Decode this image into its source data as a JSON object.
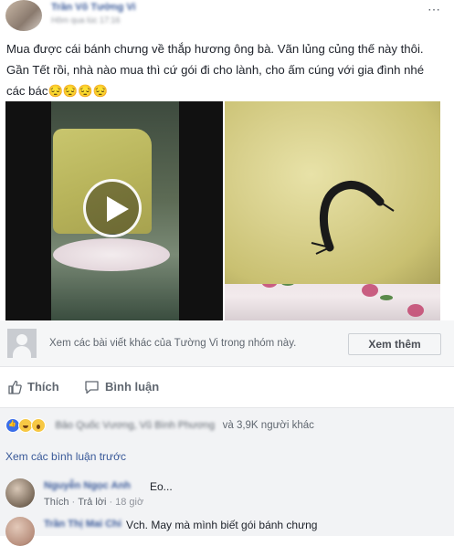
{
  "post": {
    "author": "Trần Võ Tường Vi",
    "meta": "Hôm qua lúc 17:16",
    "more_icon": "⋯",
    "caption": "Mua được cái bánh chưng về thắp hương ông bà. Vãn lủng củng thế này thôi. Gần Tết rồi, nhà nào mua thì cứ gói đi cho lành, cho ấm cúng với gia đình nhé các bác😔😔😔😔"
  },
  "group_promo": {
    "text": "Xem các bài viết khác của Tường Vi trong nhóm này.",
    "button": "Xem thêm"
  },
  "actions": {
    "like": "Thích",
    "comment": "Bình luận"
  },
  "reactions": {
    "names_blurred": "Bảo Quốc Vương, Vũ Bình Phương",
    "tail": "và 3,9K người khác"
  },
  "comments": {
    "prev_link": "Xem các bình luận trước",
    "items": [
      {
        "author": "Nguyễn Ngọc Anh",
        "text": "Eo...",
        "like": "Thích",
        "reply": "Trả lời",
        "time": "18 giờ"
      },
      {
        "author": "Trần Thị Mai Chi",
        "text": "Vch. May mà mình biết gói bánh chưng"
      }
    ]
  },
  "colors": {
    "link": "#385898",
    "text": "#1d2129",
    "muted": "#606770",
    "comment_bg": "#f2f3f5"
  },
  "icons": [
    "more-icon",
    "play-icon",
    "like-icon",
    "comment-icon",
    "group-avatar-icon"
  ]
}
